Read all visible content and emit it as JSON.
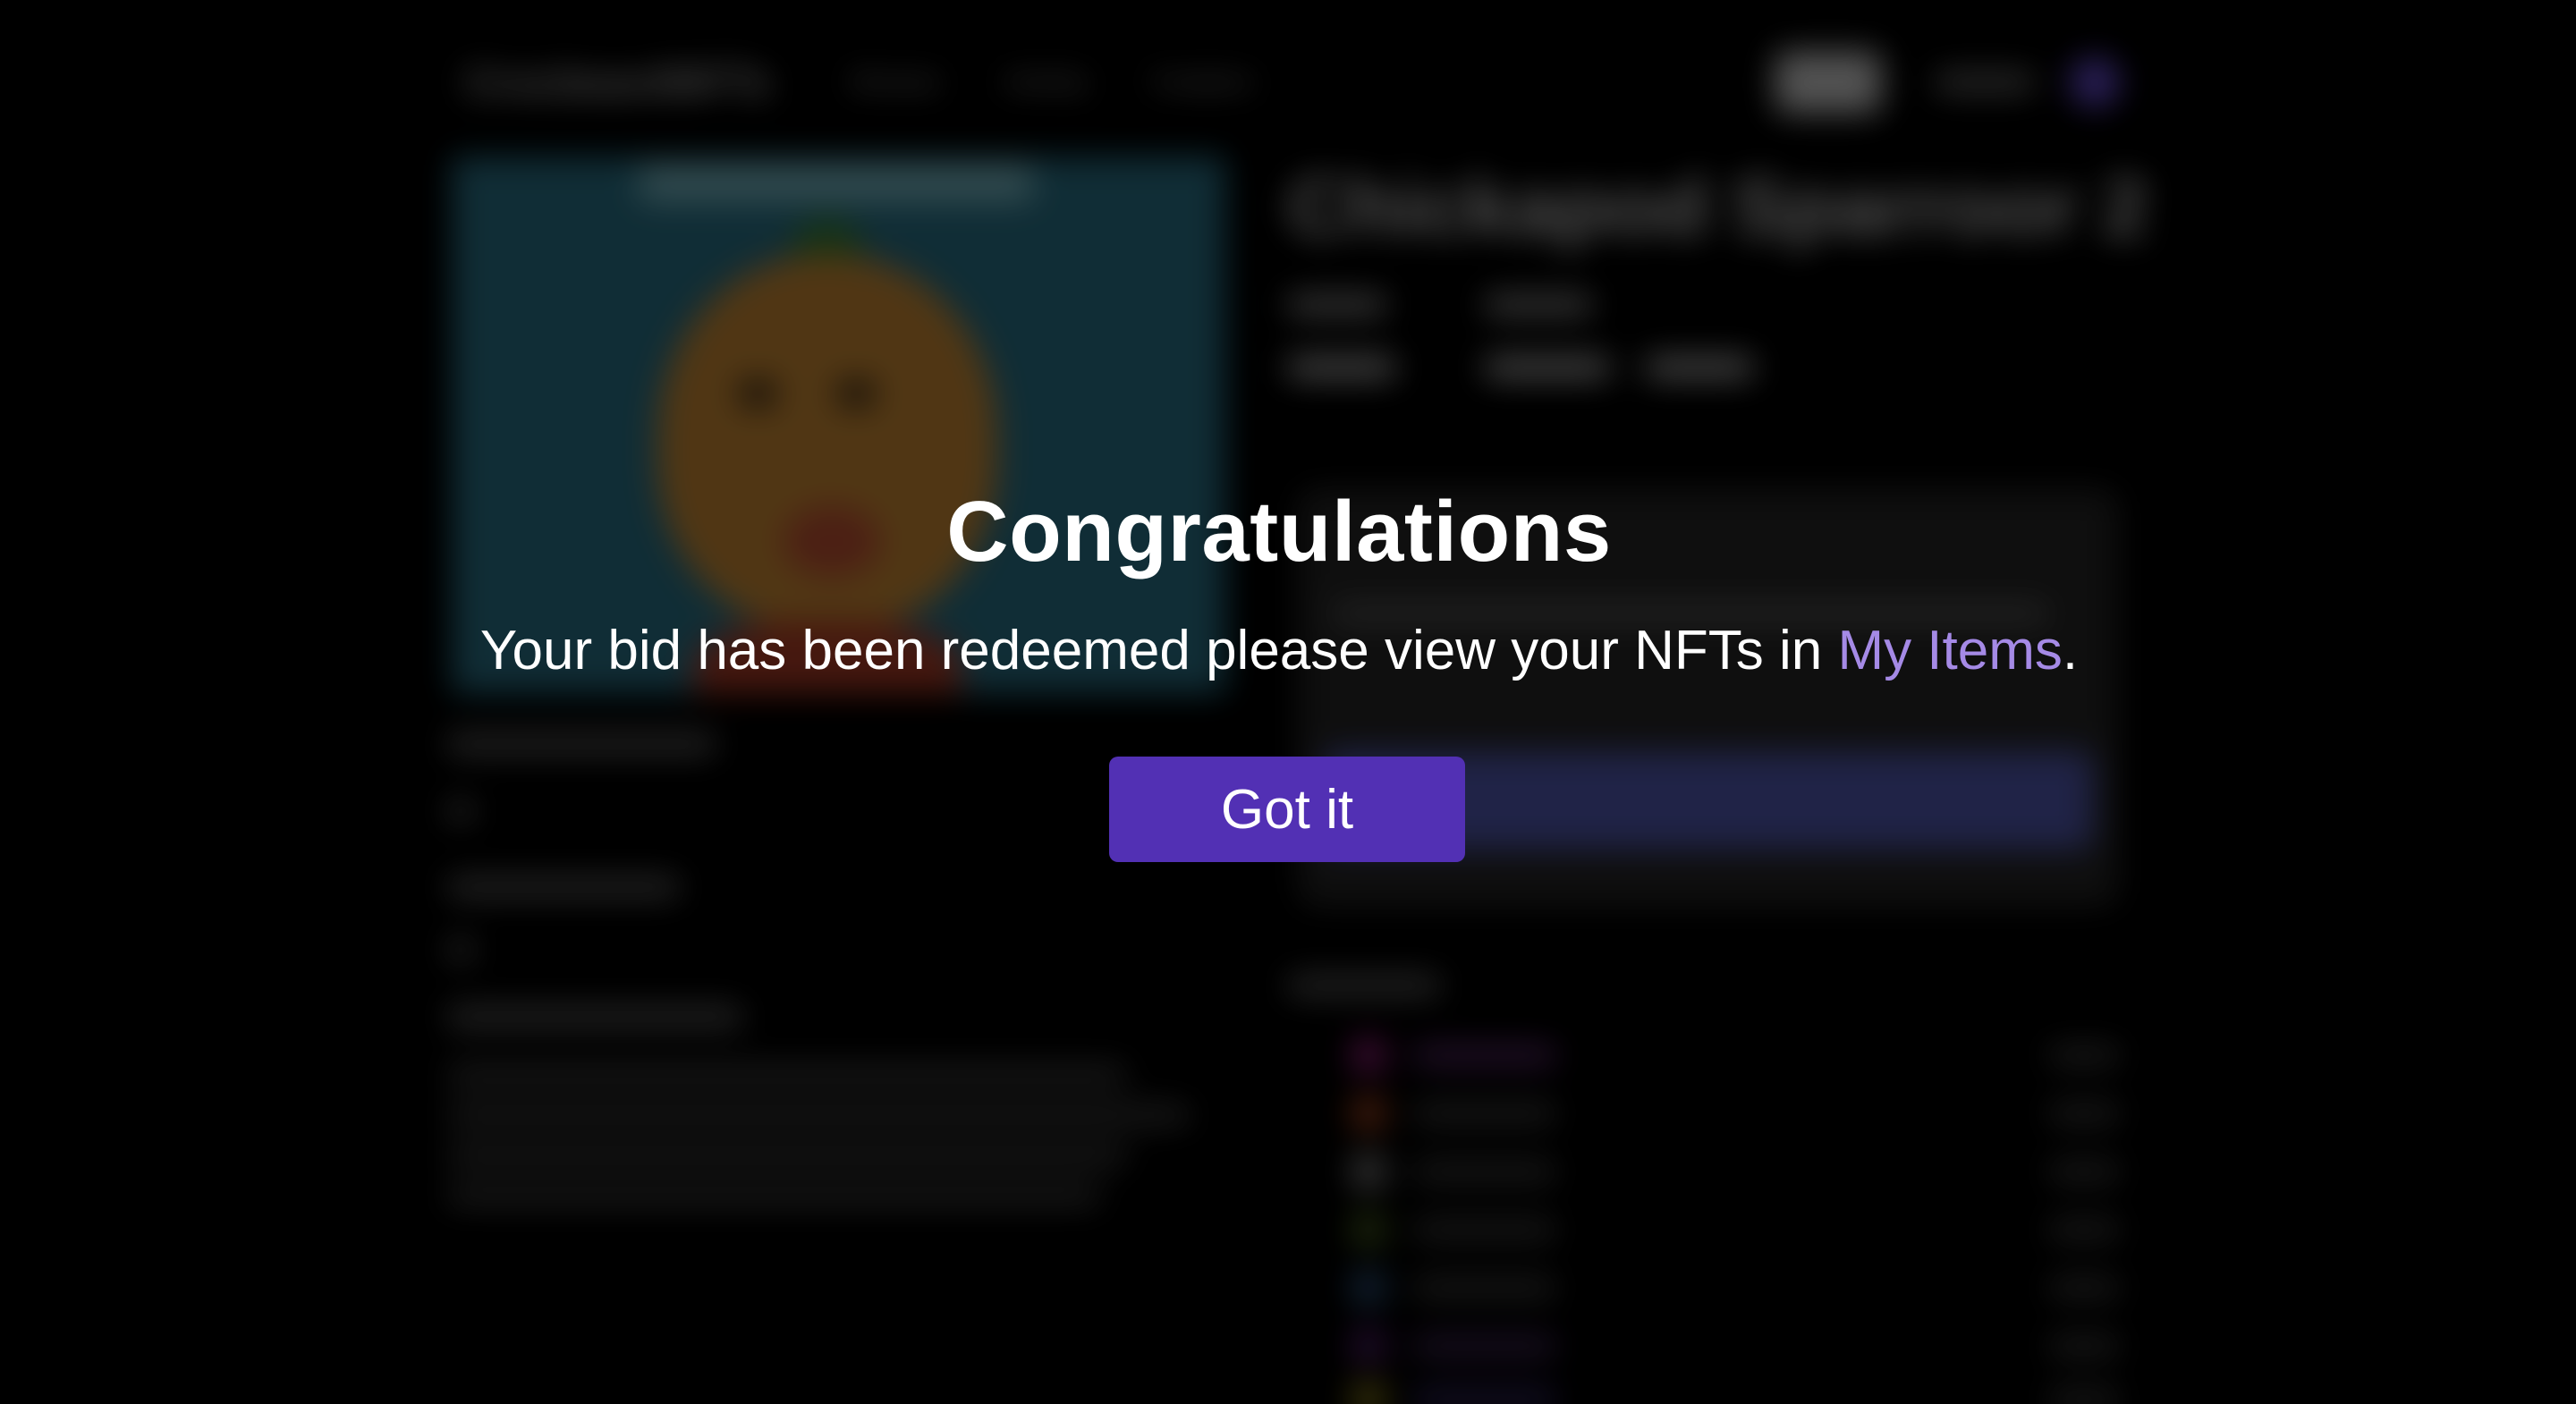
{
  "background_page": {
    "site_logo": "CrocbeardNFTs",
    "nav_links": [
      "Browse",
      "Activity",
      "Creators"
    ],
    "nft_title": "Chickapod Sparroor 2"
  },
  "modal": {
    "title": "Congratulations",
    "message_prefix": "Your bid has been redeemed please view your NFTs in ",
    "link_label": "My Items",
    "message_suffix": ".",
    "button_label": "Got it"
  },
  "colors": {
    "button_bg": "#5230b4",
    "link": "#a58ae6",
    "overlay": "#000000"
  }
}
